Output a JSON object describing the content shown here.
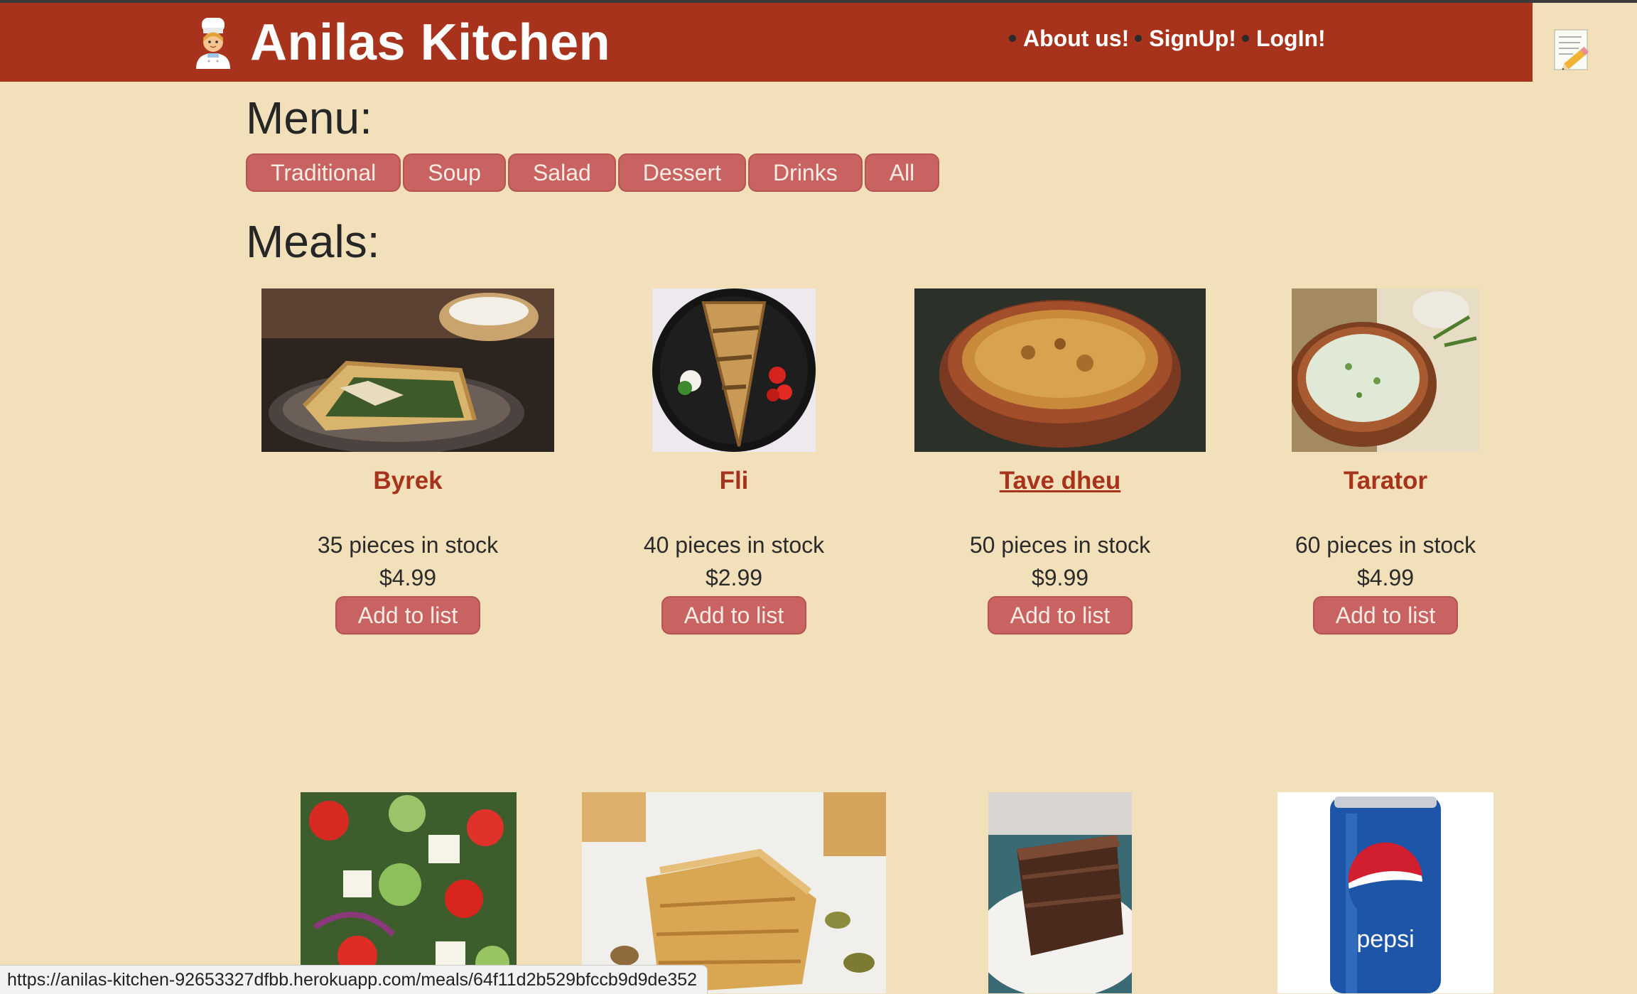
{
  "header": {
    "title": "Anilas Kitchen",
    "brand_icon": "cook-icon",
    "nav": [
      {
        "label": "About us!"
      },
      {
        "label": "SignUp!"
      },
      {
        "label": "LogIn!"
      }
    ],
    "side_icon": "notepad-pencil-icon",
    "background_color": "#a8331c"
  },
  "menu": {
    "heading": "Menu:",
    "categories": [
      "Traditional",
      "Soup",
      "Salad",
      "Dessert",
      "Drinks",
      "All"
    ]
  },
  "meals": {
    "heading": "Meals:",
    "items": [
      {
        "name": "Byrek",
        "stock": "35 pieces in stock",
        "price": "$4.99",
        "button": "Add to list",
        "image": "byrek-photo"
      },
      {
        "name": "Fli",
        "stock": "40 pieces in stock",
        "price": "$2.99",
        "button": "Add to list",
        "image": "fli-photo"
      },
      {
        "name": "Tave dheu",
        "stock": "50 pieces in stock",
        "price": "$9.99",
        "button": "Add to list",
        "image": "tave-dheu-photo"
      },
      {
        "name": "Tarator",
        "stock": "60 pieces in stock",
        "price": "$4.99",
        "button": "Add to list",
        "image": "tarator-photo"
      }
    ],
    "second_row_images": [
      "greek-salad-photo",
      "baklava-photo",
      "chocolate-cake-photo",
      "pepsi-can-photo"
    ]
  },
  "status_bar": {
    "url": "https://anilas-kitchen-92653327dfbb.herokuapp.com/meals/64f11d2b529bfccb9d9de352"
  },
  "colors": {
    "page_background": "#f1e0b9",
    "button": "#c86361",
    "accent": "#a8331c"
  }
}
